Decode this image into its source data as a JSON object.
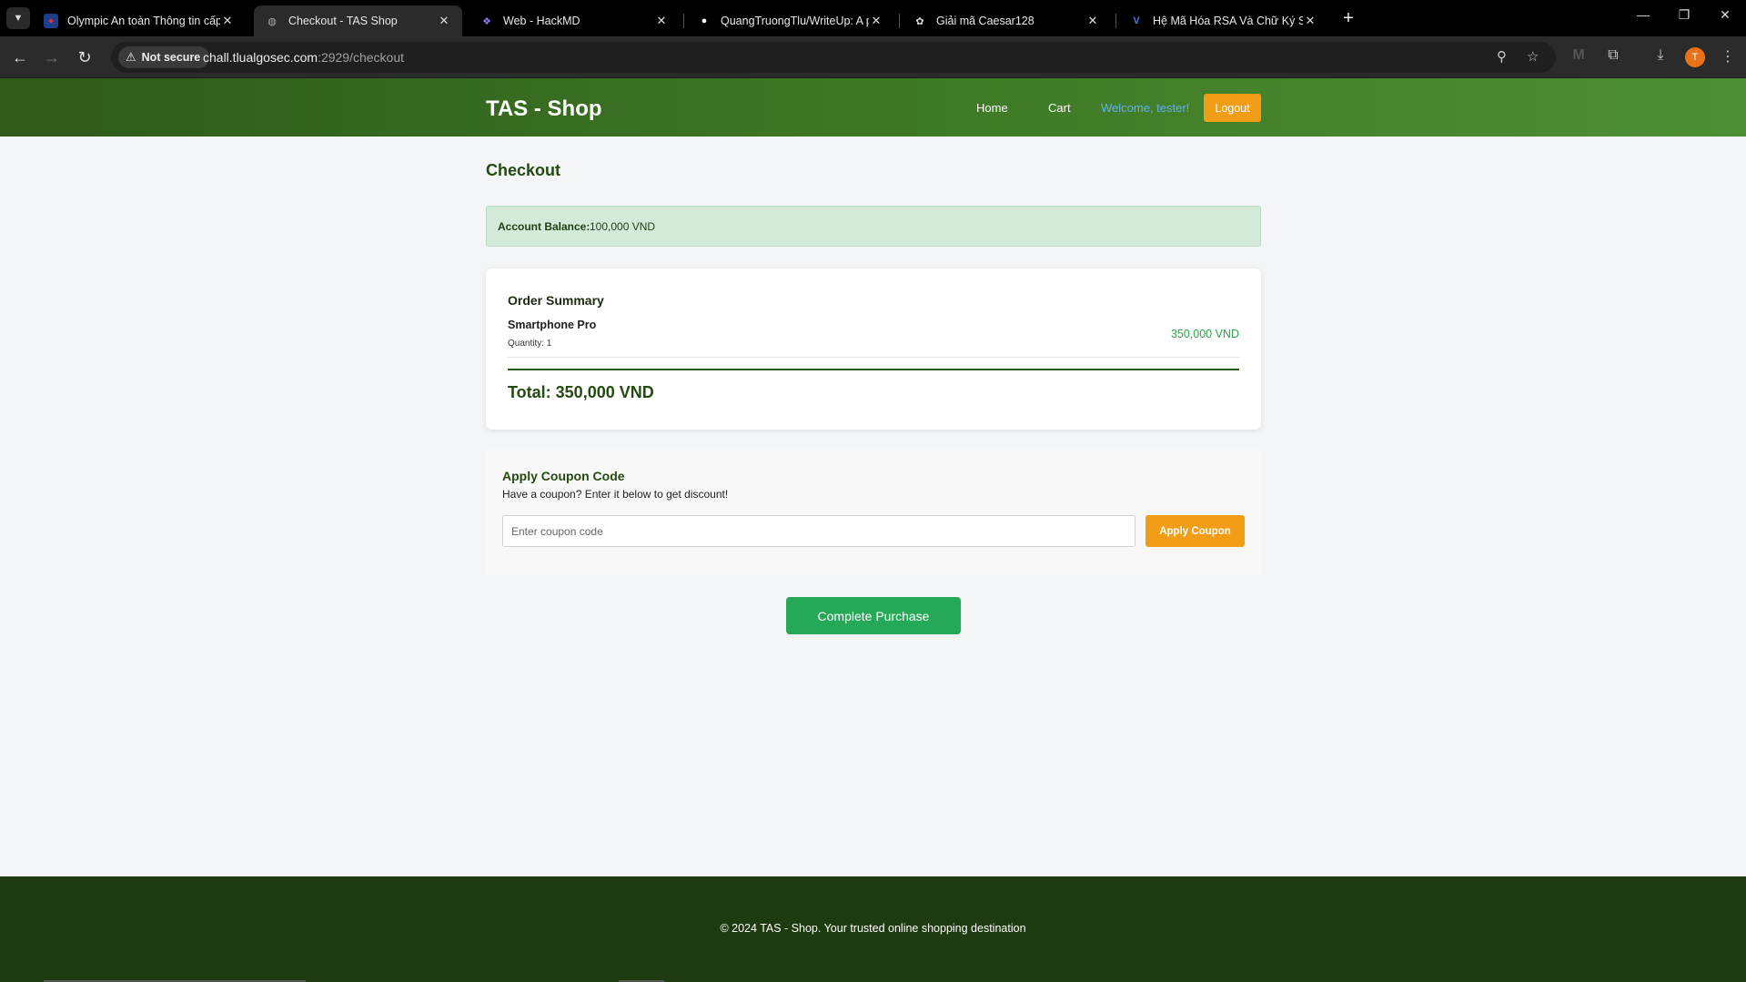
{
  "browser": {
    "tabs": [
      {
        "title": "Olympic An toàn Thông tin cấp",
        "favicon": "flag-icon",
        "active": false
      },
      {
        "title": "Checkout - TAS Shop",
        "favicon": "globe-icon",
        "active": true
      },
      {
        "title": "Web - HackMD",
        "favicon": "hackmd-icon",
        "active": false
      },
      {
        "title": "QuangTruongTlu/WriteUp: A pl",
        "favicon": "github-icon",
        "active": false
      },
      {
        "title": "Giải mã Caesar128",
        "favicon": "openai-icon",
        "active": false
      },
      {
        "title": "Hệ Mã Hóa RSA Và Chữ Ký Số -",
        "favicon": "v-icon",
        "active": false
      }
    ],
    "security_label": "Not secure",
    "url_host": "chall.tlualgosec.com",
    "url_path": ":2929/checkout",
    "profile_initial": "T"
  },
  "header": {
    "brand": "TAS - Shop",
    "nav": {
      "home": "Home",
      "cart": "Cart"
    },
    "welcome": "Welcome, tester!",
    "logout": "Logout"
  },
  "checkout": {
    "title": "Checkout",
    "balance_label": "Account Balance:",
    "balance_value": "100,000 VND",
    "summary_title": "Order Summary",
    "items": [
      {
        "name": "Smartphone Pro",
        "quantity": "Quantity: 1",
        "price": "350,000 VND"
      }
    ],
    "total": "Total: 350,000 VND"
  },
  "coupon": {
    "title": "Apply Coupon Code",
    "description": "Have a coupon? Enter it below to get discount!",
    "placeholder": "Enter coupon code",
    "value": "",
    "button": "Apply Coupon"
  },
  "purchase_button": "Complete Purchase",
  "footer": {
    "text": "© 2024 TAS - Shop. Your trusted online shopping destination"
  },
  "colors": {
    "header_green": "#3f7a26",
    "accent_orange": "#f29d16",
    "success_green": "#25a858",
    "footer_green": "#1e3a0f"
  }
}
